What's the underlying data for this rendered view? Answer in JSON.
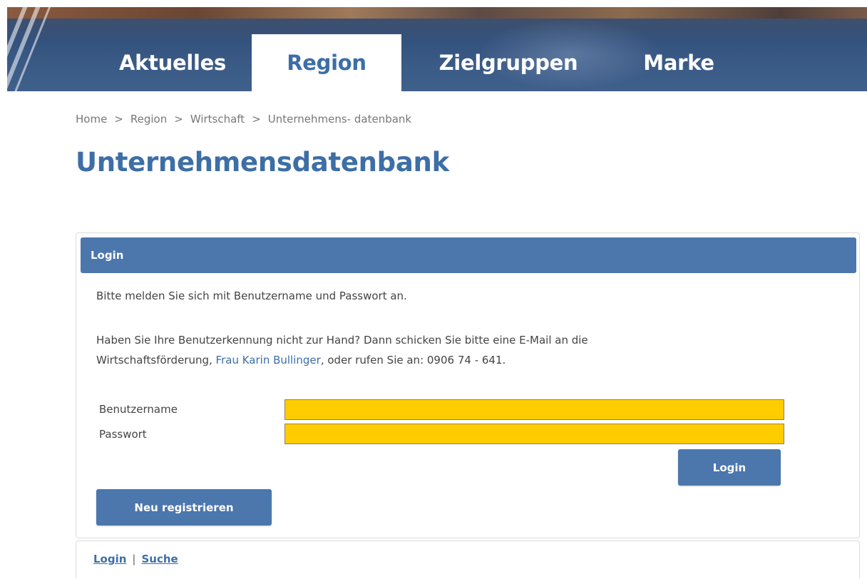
{
  "nav": {
    "tabs": [
      {
        "label": "Aktuelles"
      },
      {
        "label": "Region"
      },
      {
        "label": "Zielgruppen"
      },
      {
        "label": "Marke"
      }
    ],
    "active": "Region"
  },
  "breadcrumb": {
    "items": [
      "Home",
      "Region",
      "Wirtschaft",
      "Unternehmens- datenbank"
    ],
    "separator": ">"
  },
  "page": {
    "title": "Unternehmensdatenbank"
  },
  "login_panel": {
    "header": "Login",
    "intro": "Bitte melden Sie sich mit Benutzername und Passwort an.",
    "help_line1": "Haben Sie Ihre Benutzerkennung nicht zur Hand? Dann schicken Sie bitte eine E-Mail an die",
    "help_line2_prefix": "Wirtschaftsförderung, ",
    "help_contact_link": "Frau Karin Bullinger",
    "help_line2_suffix": ", oder rufen Sie an: 0906 74 - 641.",
    "username_label": "Benutzername",
    "username_value": "",
    "password_label": "Passwort",
    "password_value": "",
    "login_button": "Login",
    "register_button": "Neu registrieren"
  },
  "footer": {
    "login_link": "Login",
    "separator": "|",
    "search_link": "Suche"
  },
  "colors": {
    "accent": "#3d6ea6",
    "panel_header": "#4b77ad",
    "input_fill": "#ffcc00"
  }
}
